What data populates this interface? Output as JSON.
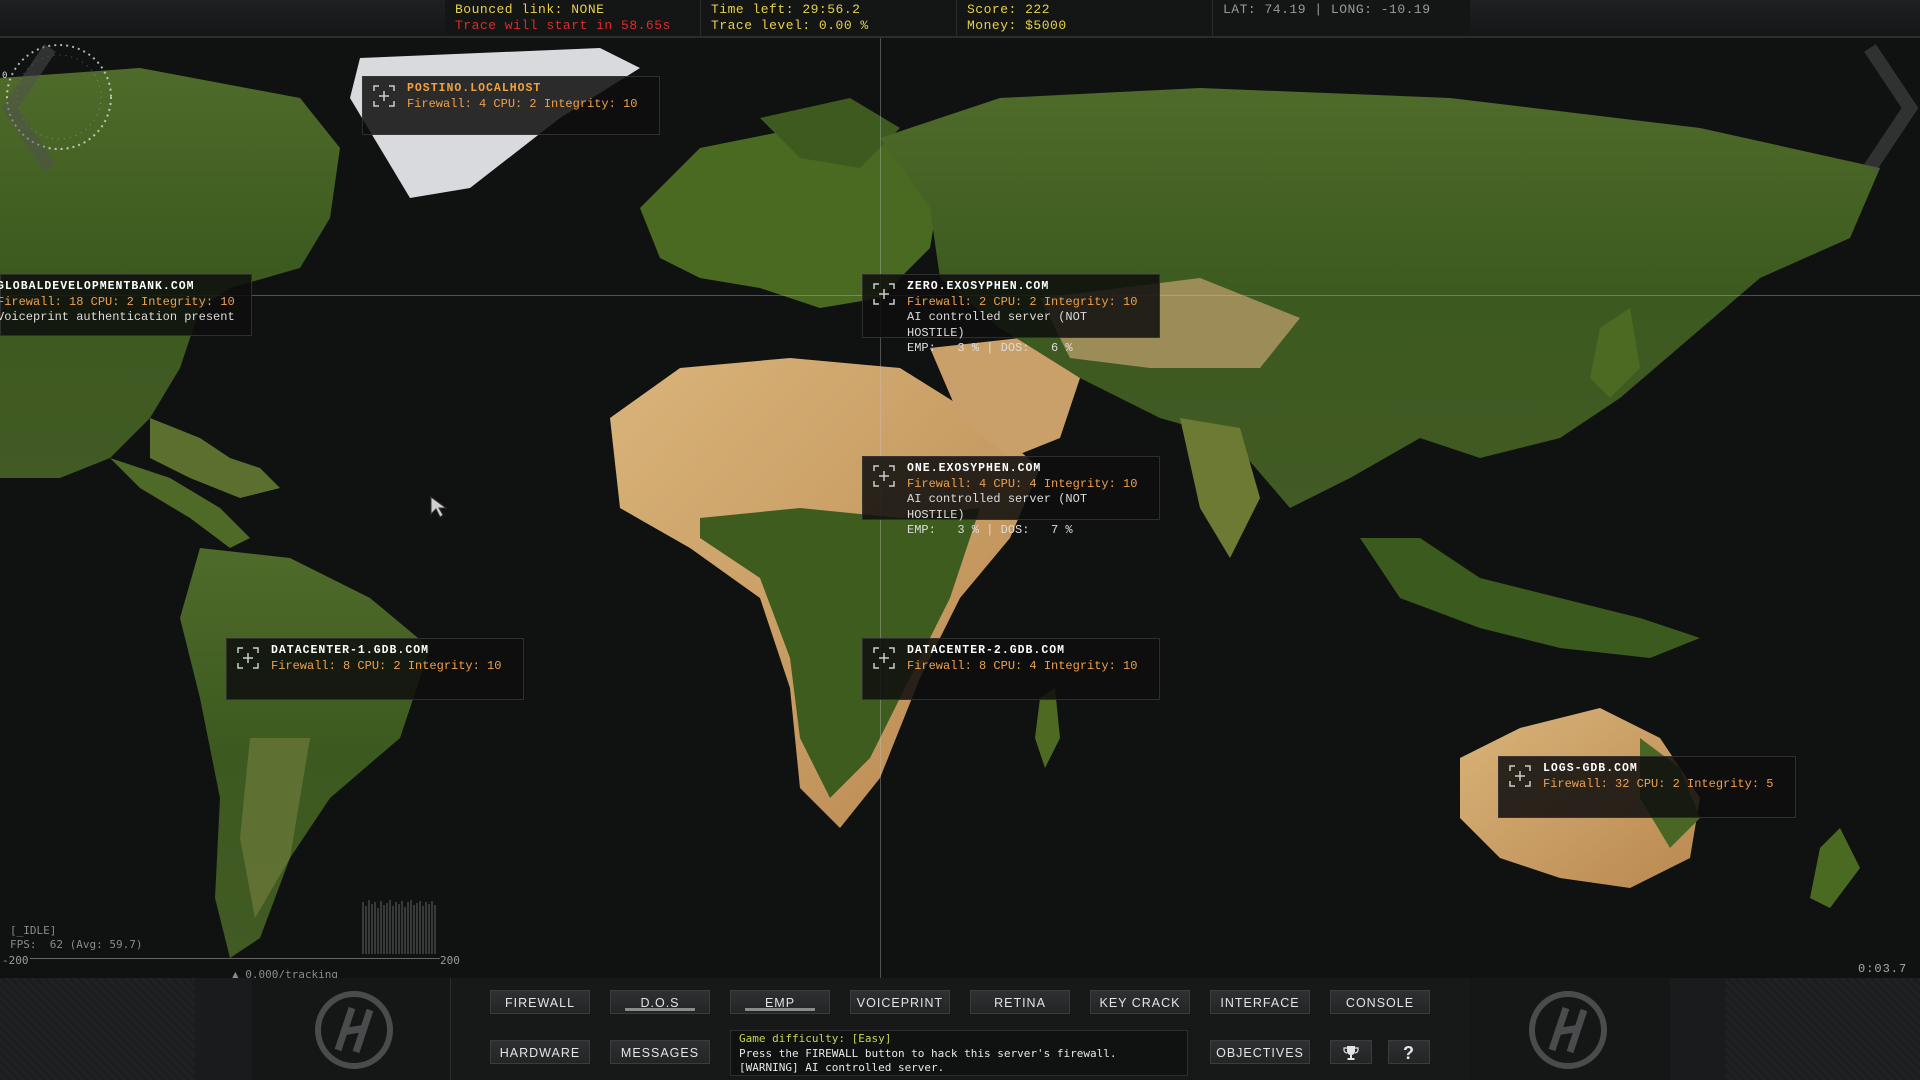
{
  "topbar": {
    "bounced_link": "Bounced link: NONE",
    "trace_start": "Trace will start in 58.65s",
    "time_left": "Time left: 29:56.2",
    "trace_level": "Trace level: 0.00 %",
    "score": "Score: 222",
    "money": "Money: $5000",
    "coords": "LAT: 74.19 | LONG: -10.19"
  },
  "servers": [
    {
      "name": "POSTINO.LOCALHOST",
      "stats": "Firewall: 4 CPU: 2 Integrity: 10"
    },
    {
      "name": "GLOBALDEVELOPMENTBANK.COM",
      "stats": "Firewall: 18 CPU: 2 Integrity: 10",
      "line1": "Voiceprint authentication present"
    },
    {
      "name": "ZERO.EXOSYPHEN.COM",
      "stats": "Firewall: 2 CPU: 2 Integrity: 10",
      "line1": "AI controlled server (NOT HOSTILE)",
      "line2": "EMP:   3 % | DOS:   6 %"
    },
    {
      "name": "ONE.EXOSYPHEN.COM",
      "stats": "Firewall: 4 CPU: 4 Integrity: 10",
      "line1": "AI controlled server (NOT HOSTILE)",
      "line2": "EMP:   3 % | DOS:   7 %"
    },
    {
      "name": "DATACENTER-1.GDB.COM",
      "stats": "Firewall: 8 CPU: 2 Integrity: 10"
    },
    {
      "name": "DATACENTER-2.GDB.COM",
      "stats": "Firewall: 8 CPU: 4 Integrity: 10"
    },
    {
      "name": "LOGS-GDB.COM",
      "stats": "Firewall: 32 CPU: 2 Integrity: 5"
    }
  ],
  "debug": {
    "status": "[_IDLE]",
    "fps": "FPS:  62 (Avg: 59.7)",
    "ruler_min": "-200",
    "ruler_max": "200",
    "tracking": "0.000/tracking"
  },
  "clock": "0:03.7",
  "buttons": {
    "firewall": "FIREWALL",
    "dos": "D.O.S",
    "emp": "EMP",
    "voiceprint": "VOICEPRINT",
    "retina": "RETINA",
    "key_crack": "KEY CRACK",
    "interface": "INTERFACE",
    "console": "CONSOLE",
    "hardware": "HARDWARE",
    "messages": "MESSAGES",
    "objectives": "OBJECTIVES",
    "help": "?"
  },
  "messages": {
    "line1": "Game difficulty: [Easy]",
    "line2": "Press the FIREWALL button to hack this server's firewall.",
    "line3": "[WARNING] AI controlled server."
  },
  "icons": [
    "target-icon",
    "trophy-icon",
    "hacker-logo-icon",
    "cursor-icon",
    "left-arrow-icon",
    "right-arrow-icon"
  ],
  "colors": {
    "accent_yellow": "#e7d04a",
    "warning_red": "#e02a2a",
    "server_orange": "#f0a04a"
  }
}
